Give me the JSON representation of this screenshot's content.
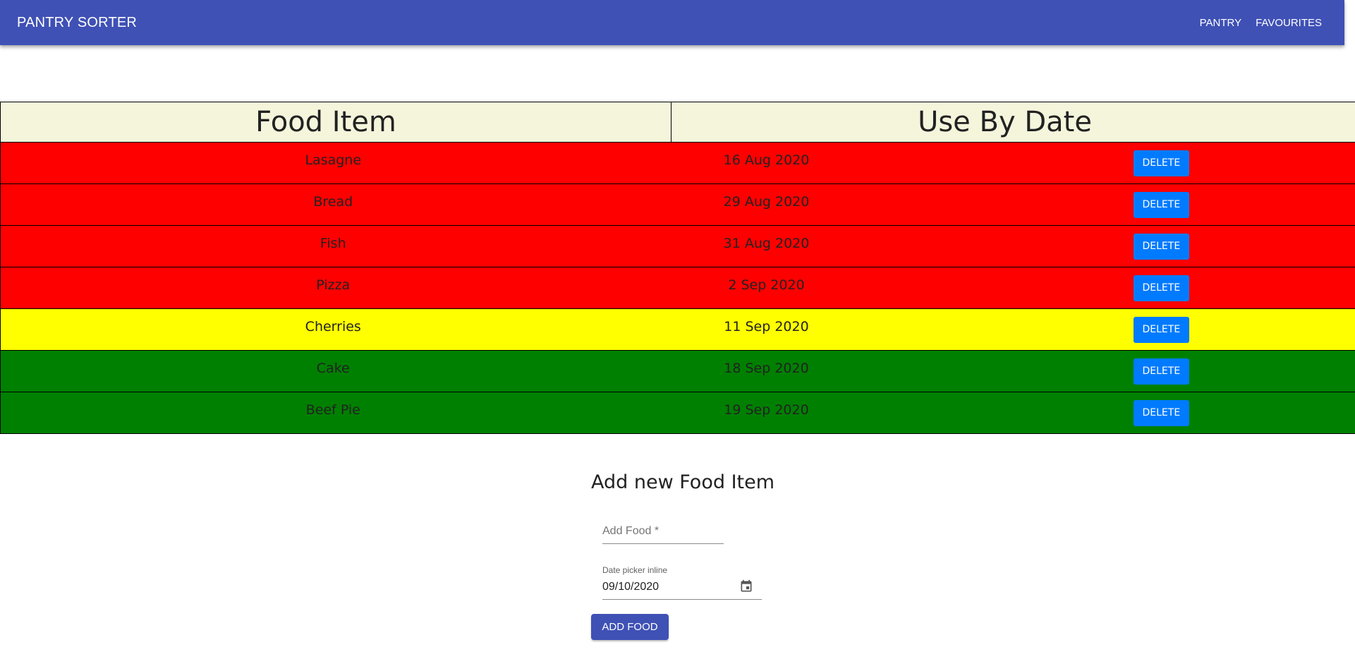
{
  "app": {
    "title": "PANTRY SORTER",
    "nav": [
      "PANTRY",
      "FAVOURITES"
    ],
    "bar_color": "#3f51b5"
  },
  "table": {
    "headers": [
      "Food Item",
      "Use By Date"
    ],
    "delete_label": "DELETE",
    "rows": [
      {
        "food": "Lasagne",
        "date": "16 Aug 2020",
        "color": "#ff0000"
      },
      {
        "food": "Bread",
        "date": "29 Aug 2020",
        "color": "#ff0000"
      },
      {
        "food": "Fish",
        "date": "31 Aug 2020",
        "color": "#ff0000"
      },
      {
        "food": "Pizza",
        "date": "2 Sep 2020",
        "color": "#ff0000"
      },
      {
        "food": "Cherries",
        "date": "11 Sep 2020",
        "color": "#ffff00"
      },
      {
        "food": "Cake",
        "date": "18 Sep 2020",
        "color": "#008000"
      },
      {
        "food": "Beef Pie",
        "date": "19 Sep 2020",
        "color": "#008000"
      }
    ]
  },
  "form": {
    "title": "Add new Food Item",
    "food_placeholder": "Add Food *",
    "date_label": "Date picker inline",
    "date_value": "09/10/2020",
    "submit_label": "ADD FOOD"
  },
  "icons": {
    "calendar": "calendar-icon"
  }
}
